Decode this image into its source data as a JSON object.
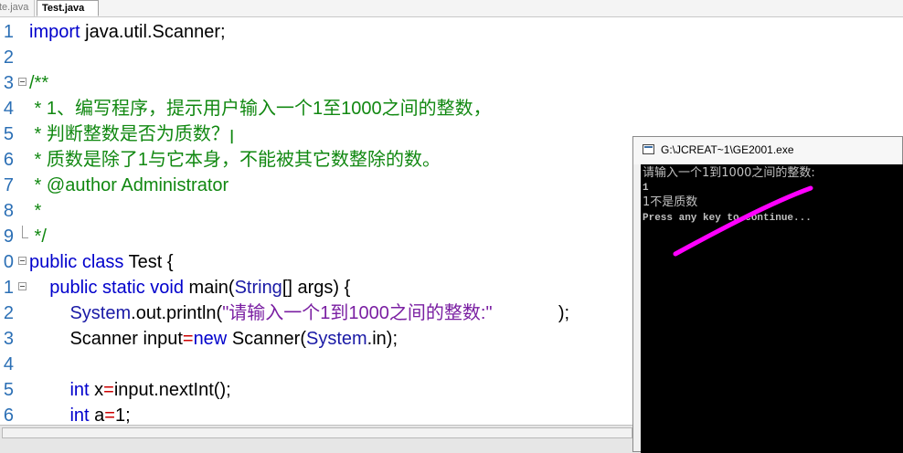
{
  "tabs": [
    {
      "label": "te.java",
      "active": false
    },
    {
      "label": "Test.java",
      "active": true
    }
  ],
  "editor": {
    "lines": [
      {
        "num": "1",
        "fold": "",
        "tokens": [
          {
            "t": "import",
            "c": "kw"
          },
          {
            "t": " java.util.Scanner;",
            "c": "pl"
          }
        ]
      },
      {
        "num": "2",
        "fold": "",
        "tokens": []
      },
      {
        "num": "3",
        "fold": "open",
        "tokens": [
          {
            "t": "/**",
            "c": "cm"
          }
        ]
      },
      {
        "num": "4",
        "fold": "",
        "tokens": [
          {
            "t": " * 1、编写程序，提示用户输入一个1至1000之间的整数，",
            "c": "cm"
          }
        ]
      },
      {
        "num": "5",
        "fold": "",
        "tokens": [
          {
            "t": " * 判断整数是否为质数？ꞁ",
            "c": "cm"
          }
        ]
      },
      {
        "num": "6",
        "fold": "",
        "tokens": [
          {
            "t": " * 质数是除了1与它本身，不能被其它数整除的数。",
            "c": "cm"
          }
        ]
      },
      {
        "num": "7",
        "fold": "",
        "tokens": [
          {
            "t": " * @author Administrator",
            "c": "cm"
          }
        ]
      },
      {
        "num": "8",
        "fold": "",
        "tokens": [
          {
            "t": " *",
            "c": "cm"
          }
        ]
      },
      {
        "num": "9",
        "fold": "end",
        "tokens": [
          {
            "t": " */",
            "c": "cm"
          }
        ]
      },
      {
        "num": "0",
        "fold": "open",
        "tokens": [
          {
            "t": "public class",
            "c": "kw"
          },
          {
            "t": " Test {",
            "c": "pl"
          }
        ]
      },
      {
        "num": "1",
        "fold": "open",
        "tokens": [
          {
            "t": "    ",
            "c": "pl"
          },
          {
            "t": "public static void",
            "c": "kw"
          },
          {
            "t": " main(",
            "c": "pl"
          },
          {
            "t": "String",
            "c": "cls"
          },
          {
            "t": "[] args) {",
            "c": "pl"
          }
        ]
      },
      {
        "num": "2",
        "fold": "",
        "tokens": [
          {
            "t": "        ",
            "c": "pl"
          },
          {
            "t": "System",
            "c": "cls"
          },
          {
            "t": ".out.println(",
            "c": "pl"
          },
          {
            "t": "\"请输入一个1到1000之间的整数:\"",
            "c": "st"
          },
          {
            "t": "             );",
            "c": "pl"
          }
        ]
      },
      {
        "num": "3",
        "fold": "",
        "tokens": [
          {
            "t": "        Scanner input",
            "c": "pl"
          },
          {
            "t": "=",
            "c": "op"
          },
          {
            "t": "new",
            "c": "kw"
          },
          {
            "t": " Scanner(",
            "c": "pl"
          },
          {
            "t": "System",
            "c": "cls"
          },
          {
            "t": ".in);",
            "c": "pl"
          }
        ]
      },
      {
        "num": "4",
        "fold": "",
        "tokens": []
      },
      {
        "num": "5",
        "fold": "",
        "tokens": [
          {
            "t": "        ",
            "c": "pl"
          },
          {
            "t": "int",
            "c": "kw"
          },
          {
            "t": " x",
            "c": "pl"
          },
          {
            "t": "=",
            "c": "op"
          },
          {
            "t": "input.nextInt();",
            "c": "pl"
          }
        ]
      },
      {
        "num": "6",
        "fold": "",
        "tokens": [
          {
            "t": "        ",
            "c": "pl"
          },
          {
            "t": "int",
            "c": "kw"
          },
          {
            "t": " a",
            "c": "pl"
          },
          {
            "t": "=",
            "c": "op"
          },
          {
            "t": "1;",
            "c": "pl"
          }
        ]
      }
    ]
  },
  "console": {
    "title": "G:\\JCREAT~1\\GE2001.exe",
    "output": [
      "请输入一个1到1000之间的整数:",
      "1",
      "1不是质数",
      "Press any key to continue..."
    ]
  },
  "colors": {
    "keyword": "#0000cc",
    "comment": "#118811",
    "string": "#7a1fa2",
    "operator": "#cc0000",
    "line_number": "#2b6fb5",
    "annotation_stroke": "#ff00ff"
  }
}
